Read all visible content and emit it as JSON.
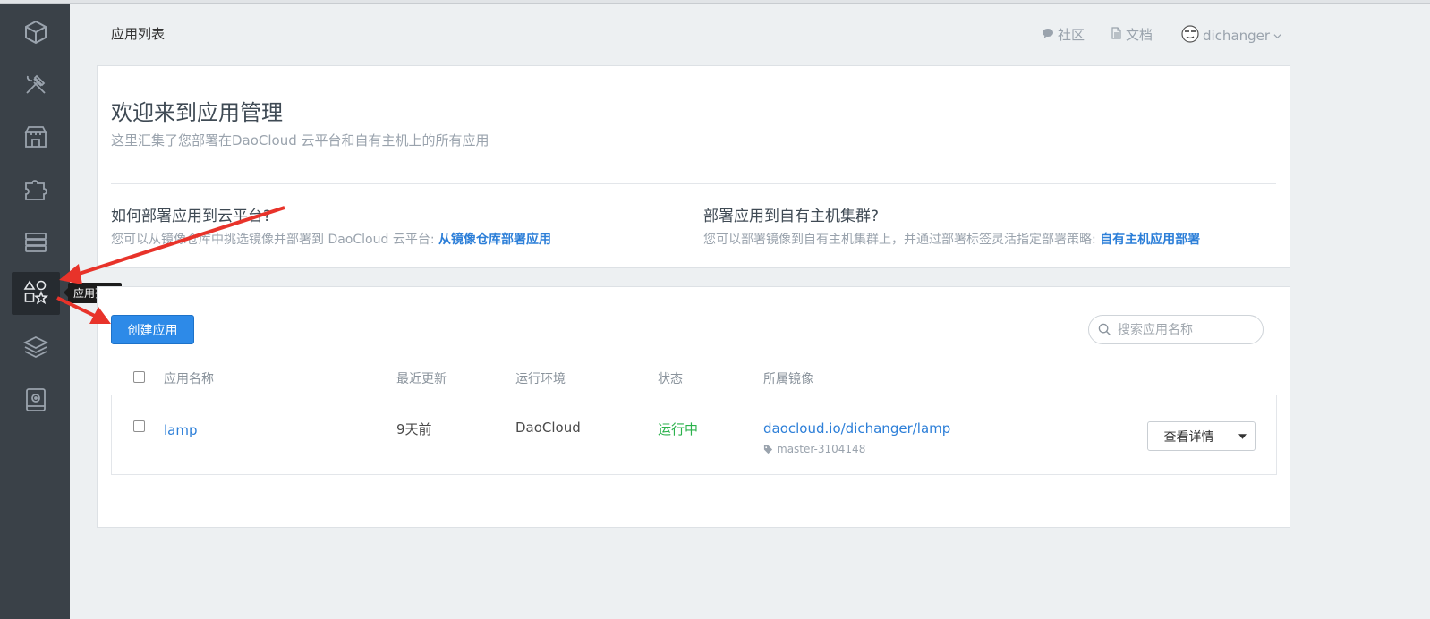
{
  "header": {
    "title": "应用列表",
    "community": "社区",
    "docs": "文档",
    "username": "dichanger"
  },
  "sidebar": {
    "tooltip": "应用列表",
    "items": [
      {
        "icon": "logo-cube-icon"
      },
      {
        "icon": "tools-icon"
      },
      {
        "icon": "store-icon"
      },
      {
        "icon": "puzzle-icon"
      },
      {
        "icon": "server-icon"
      },
      {
        "icon": "shapes-icon",
        "active": true
      },
      {
        "icon": "layers-icon"
      },
      {
        "icon": "storage-icon"
      }
    ]
  },
  "welcome": {
    "title": "欢迎来到应用管理",
    "subtitle": "这里汇集了您部署在DaoCloud 云平台和自有主机上的所有应用",
    "left": {
      "title": "如何部署应用到云平台?",
      "desc": "您可以从镜像仓库中挑选镜像并部署到 DaoCloud 云平台: ",
      "link": "从镜像仓库部署应用"
    },
    "right": {
      "title": "部署应用到自有主机集群?",
      "desc": "您可以部署镜像到自有主机集群上，并通过部署标签灵活指定部署策略: ",
      "link": "自有主机应用部署"
    }
  },
  "apps": {
    "create_label": "创建应用",
    "search_placeholder": "搜索应用名称",
    "columns": [
      "应用名称",
      "最近更新",
      "运行环境",
      "状态",
      "所属镜像"
    ],
    "rows": [
      {
        "name": "lamp",
        "updated": "9天前",
        "env": "DaoCloud",
        "status": "运行中",
        "image": "daocloud.io/dichanger/lamp",
        "tag": "master-3104148",
        "action": "查看详情"
      }
    ]
  },
  "colors": {
    "sidebar": "#3a4148",
    "primary": "#2d8ae8",
    "link": "#2d7fd8",
    "running": "#2bb24c",
    "annotation_arrow": "#e8332a"
  }
}
